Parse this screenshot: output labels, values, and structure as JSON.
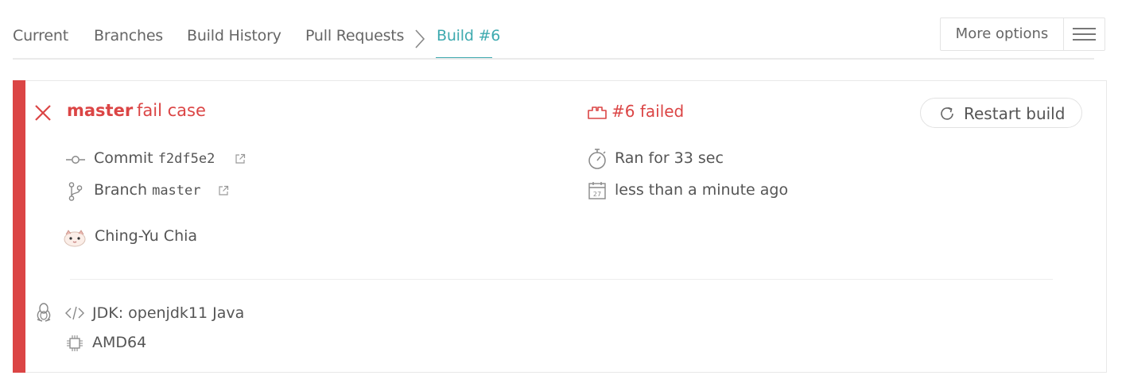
{
  "nav": {
    "tabs": [
      {
        "label": "Current"
      },
      {
        "label": "Branches"
      },
      {
        "label": "Build History"
      },
      {
        "label": "Pull Requests"
      }
    ],
    "breadcrumb_current": "Build #6",
    "more_options_label": "More options"
  },
  "build": {
    "status": "failed",
    "status_color": "#db4545",
    "accent_color": "#3eaaaf",
    "branch": "master",
    "commit_message": "fail case",
    "status_text": "#6 failed",
    "restart_label": "Restart build",
    "commit_label": "Commit",
    "commit_sha": "f2df5e2",
    "branch_label": "Branch",
    "branch_value": "master",
    "author": "Ching-Yu Chia",
    "duration": "Ran for 33 sec",
    "finished": "less than a minute ago",
    "calendar_day": "27",
    "jdk": "JDK: openjdk11 Java",
    "arch": "AMD64",
    "os_icon": "linux-icon"
  }
}
